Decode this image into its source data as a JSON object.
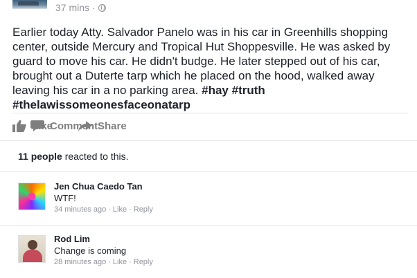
{
  "post": {
    "timestamp": "37 mins",
    "separator": "·",
    "privacy_icon": "globe-icon",
    "text": "Earlier today Atty. Salvador Panelo was in his car in Greenhills shopping center, outside Mercury and Tropical Hut Shoppesville. He was asked by guard to move his car. He didn't budge. He later stepped out of his car, brought out a Duterte tarp which he placed on the hood, walked away leaving his car in a no parking area.",
    "hashtags": [
      "#hay",
      "#truth",
      "#thelawissomeonesfaceonatarp"
    ]
  },
  "actions": {
    "like": "Like",
    "comment": "Comment",
    "share": "Share"
  },
  "reactions": {
    "count_label": "11 people",
    "suffix": " reacted to this."
  },
  "comments": [
    {
      "name": "Jen Chua Caedo Tan",
      "text": "WTF!",
      "time": "34 minutes ago",
      "like": "Like",
      "reply": "Reply",
      "dot": "·"
    },
    {
      "name": "Rod Lim",
      "text": "Change is coming",
      "time": "28 minutes ago",
      "like": "Like",
      "reply": "Reply",
      "dot": "·"
    }
  ],
  "colors": {
    "text": "#1d2129",
    "muted": "#90949c",
    "action": "#7f7f7f",
    "divider": "#e5e5e5"
  }
}
